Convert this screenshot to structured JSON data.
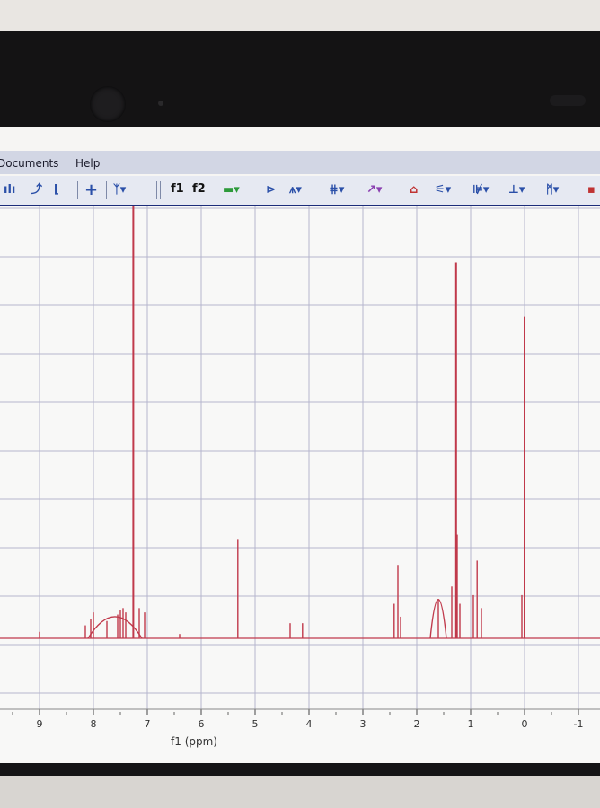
{
  "menu": {
    "documents": "Documents",
    "help": "Help"
  },
  "toolbar": {
    "f1_label": "f1",
    "f2_label": "f2",
    "icons": [
      "peak-pick-icon",
      "integrate-icon",
      "crosshair-icon",
      "phase-icon",
      "zoom-icon",
      "fit-icon",
      "baseline-icon",
      "multiplet-icon",
      "analysis-icon",
      "predict-icon",
      "color-icon"
    ]
  },
  "plot": {
    "axis_label": "f1 (ppm)",
    "x_ticks": [
      "9",
      "8",
      "7",
      "6",
      "5",
      "4",
      "3",
      "2",
      "1",
      "0",
      "-1"
    ],
    "spectrum_color": "#c0394b",
    "grid_color": "#b6b6ce",
    "canvas_color": "#f8f8f7"
  },
  "chart_data": {
    "type": "line",
    "xlabel": "f1 (ppm)",
    "xlim": [
      9.7,
      -1.2
    ],
    "x_reversed": true,
    "ylim": [
      0,
      1
    ],
    "grid": true,
    "peaks": [
      {
        "x": 9.0,
        "y": 0.015
      },
      {
        "x": 8.15,
        "y": 0.03
      },
      {
        "x": 8.05,
        "y": 0.045
      },
      {
        "x": 8.0,
        "y": 0.06
      },
      {
        "x": 7.75,
        "y": 0.04
      },
      {
        "x": 7.55,
        "y": 0.055
      },
      {
        "x": 7.5,
        "y": 0.065
      },
      {
        "x": 7.45,
        "y": 0.07
      },
      {
        "x": 7.4,
        "y": 0.06
      },
      {
        "x": 7.26,
        "y": 1.0
      },
      {
        "x": 7.15,
        "y": 0.07
      },
      {
        "x": 7.05,
        "y": 0.06
      },
      {
        "x": 6.4,
        "y": 0.01
      },
      {
        "x": 5.32,
        "y": 0.23
      },
      {
        "x": 4.35,
        "y": 0.035
      },
      {
        "x": 4.12,
        "y": 0.035
      },
      {
        "x": 2.42,
        "y": 0.08
      },
      {
        "x": 2.35,
        "y": 0.17
      },
      {
        "x": 2.3,
        "y": 0.05
      },
      {
        "x": 1.6,
        "y": 0.09
      },
      {
        "x": 1.35,
        "y": 0.12
      },
      {
        "x": 1.27,
        "y": 0.87
      },
      {
        "x": 1.25,
        "y": 0.24
      },
      {
        "x": 1.2,
        "y": 0.08
      },
      {
        "x": 0.95,
        "y": 0.1
      },
      {
        "x": 0.88,
        "y": 0.18
      },
      {
        "x": 0.8,
        "y": 0.07
      },
      {
        "x": 0.05,
        "y": 0.1
      },
      {
        "x": 0.0,
        "y": 0.745
      }
    ]
  }
}
